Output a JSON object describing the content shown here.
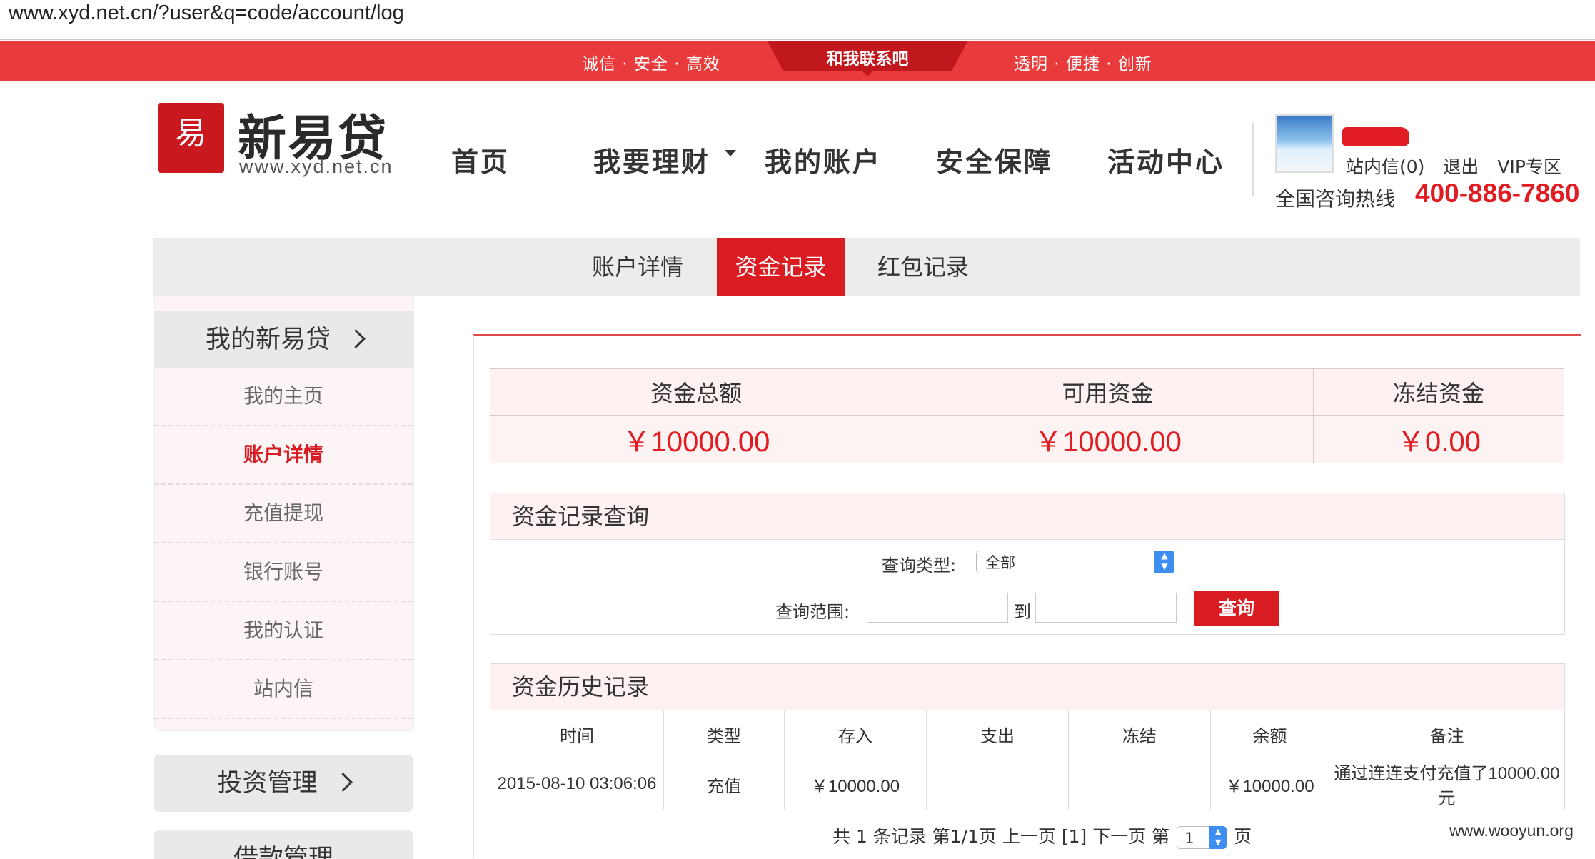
{
  "browser": {
    "url": "www.xyd.net.cn/?user&q=code/account/log"
  },
  "topstrip": {
    "left_slogan": "诚信 · 安全 · 高效",
    "center_tab": "和我联系吧",
    "right_slogan": "透明 · 便捷 · 创新"
  },
  "logo": {
    "seal_text": "易",
    "name": "新易贷",
    "url": "www.xyd.net.cn"
  },
  "nav": {
    "items": [
      {
        "label": "首页"
      },
      {
        "label": "我要理财"
      },
      {
        "label": "我的账户"
      },
      {
        "label": "安全保障"
      },
      {
        "label": "活动中心"
      }
    ]
  },
  "user": {
    "inbox": "站内信(0)",
    "logout": "退出",
    "vip": "VIP专区",
    "hotline_label": "全国咨询热线",
    "hotline_number": "400-886-7860"
  },
  "subtabs": [
    {
      "label": "账户详情"
    },
    {
      "label": "资金记录"
    },
    {
      "label": "红包记录"
    }
  ],
  "sidebar": {
    "section1_title": "我的新易贷",
    "items": [
      {
        "label": "我的主页"
      },
      {
        "label": "账户详情"
      },
      {
        "label": "充值提现"
      },
      {
        "label": "银行账号"
      },
      {
        "label": "我的认证"
      },
      {
        "label": "站内信"
      }
    ],
    "section2_title": "投资管理",
    "section3_title": "借款管理"
  },
  "summary": {
    "headers": [
      "资金总额",
      "可用资金",
      "冻结资金"
    ],
    "values": [
      "￥10000.00",
      "￥10000.00",
      "￥0.00"
    ]
  },
  "query": {
    "title": "资金记录查询",
    "type_label": "查询类型:",
    "type_value": "全部",
    "range_label": "查询范围:",
    "range_to": "到",
    "button": "查询"
  },
  "history": {
    "title": "资金历史记录",
    "columns": [
      "时间",
      "类型",
      "存入",
      "支出",
      "冻结",
      "余额",
      "备注"
    ],
    "rows": [
      [
        "2015-08-10 03:06:06",
        "充值",
        "￥10000.00",
        "",
        "",
        "￥10000.00",
        "通过连连支付充值了10000.00元"
      ]
    ]
  },
  "pager": {
    "summary": "共 1 条记录 第1/1页 上一页 [1] 下一页 第",
    "page_value": "1",
    "suffix": "页"
  },
  "watermark": "www.wooyun.org",
  "colors": {
    "brand_red": "#d91c22",
    "strip_red": "#e93b3b",
    "select_blue": "#3d8ef0"
  }
}
